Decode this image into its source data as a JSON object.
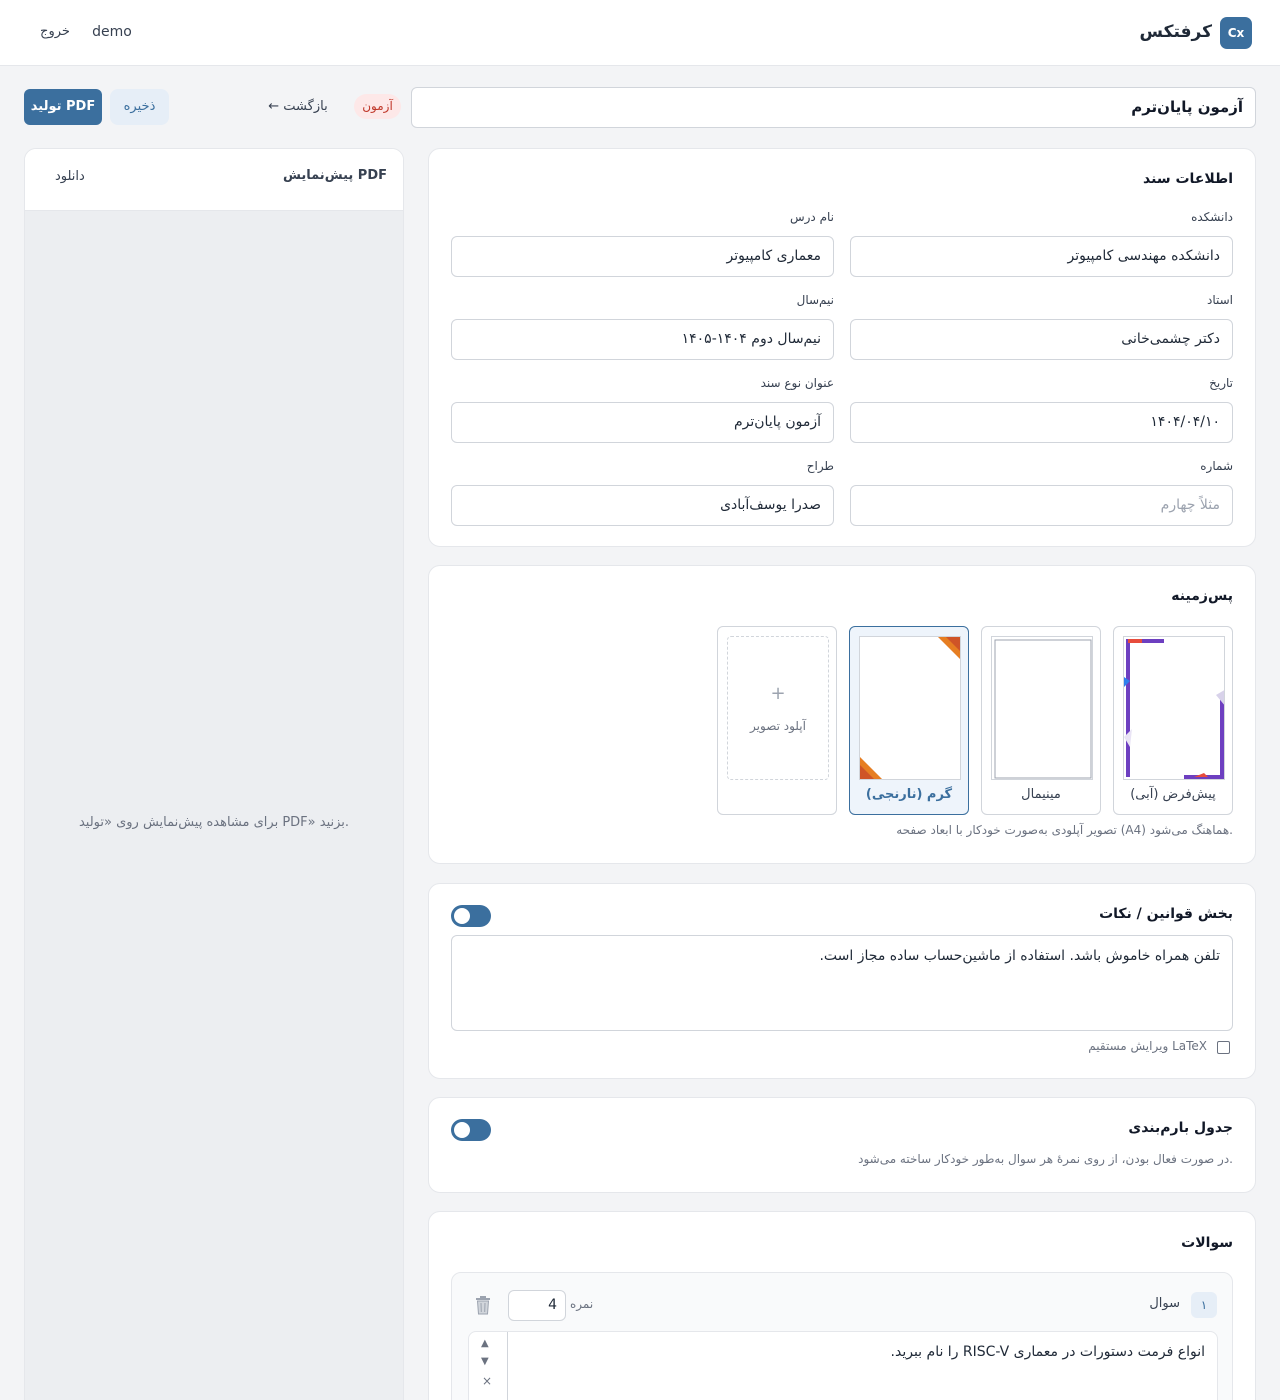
{
  "header": {
    "logo": "Cx",
    "brand": "کرفتکس",
    "user": "demo",
    "logout": "خروج"
  },
  "toolbar": {
    "doc_title": "آزمون پایان‌ترم",
    "badge": "آزمون",
    "back": "← بازگشت",
    "save": "ذخیره",
    "generate": "تولید PDF"
  },
  "preview": {
    "title": "پیش‌نمایش PDF",
    "download": "دانلود",
    "empty": "برای مشاهده پیش‌نمایش روی «تولید PDF» بزنید."
  },
  "doc_info": {
    "title": "اطلاعات سند",
    "fields": {
      "faculty": {
        "label": "دانشکده",
        "value": "دانشکده مهندسی کامپیوتر"
      },
      "course": {
        "label": "نام درس",
        "value": "معماری کامپیوتر"
      },
      "professor": {
        "label": "استاد",
        "value": "دکتر چشمی‌خانی"
      },
      "semester": {
        "label": "نیم‌سال",
        "value": "نیم‌سال دوم ۱۴۰۴-۱۴۰۵"
      },
      "date": {
        "label": "تاریخ",
        "value": "۱۴۰۴/۰۴/۱۰"
      },
      "doc_type": {
        "label": "عنوان نوع سند",
        "value": "آزمون پایان‌ترم"
      },
      "number": {
        "label": "شماره",
        "value": "",
        "placeholder": "مثلاً چهارم"
      },
      "designer": {
        "label": "طراح",
        "value": "صدرا یوسف‌آبادی"
      }
    }
  },
  "backgrounds": {
    "title": "پس‌زمینه",
    "options": [
      {
        "name": "پیش‌فرض (آبی)",
        "selected": false
      },
      {
        "name": "مینیمال",
        "selected": false
      },
      {
        "name": "گرم (نارنجی)",
        "selected": true
      }
    ],
    "upload": {
      "icon": "+",
      "label": "آپلود تصویر"
    },
    "hint": "تصویر آپلودی به‌صورت خودکار با ابعاد صفحه (A4) هماهنگ می‌شود."
  },
  "rules": {
    "title": "بخش قوانین / نکات",
    "enabled": false,
    "text": "تلفن همراه خاموش باشد. استفاده از ماشین‌حساب ساده مجاز است.",
    "latex_label": "ویرایش مستقیم LaTeX",
    "latex_checked": false
  },
  "grading": {
    "title": "جدول بارم‌بندی",
    "enabled": false,
    "hint": "در صورت فعال بودن، از روی نمرهٔ هر سوال به‌طور خودکار ساخته می‌شود."
  },
  "questions": {
    "title": "سوالات",
    "items": [
      {
        "number": "۱",
        "label": "سوال",
        "score_label": "نمره",
        "score": "4",
        "text": "انواع فرمت دستورات در معماری RISC-V را نام ببرید."
      }
    ]
  },
  "colors": {
    "accent": "#3b6f9e",
    "badge_bg": "#fde8e8",
    "badge_text": "#c0392b"
  }
}
